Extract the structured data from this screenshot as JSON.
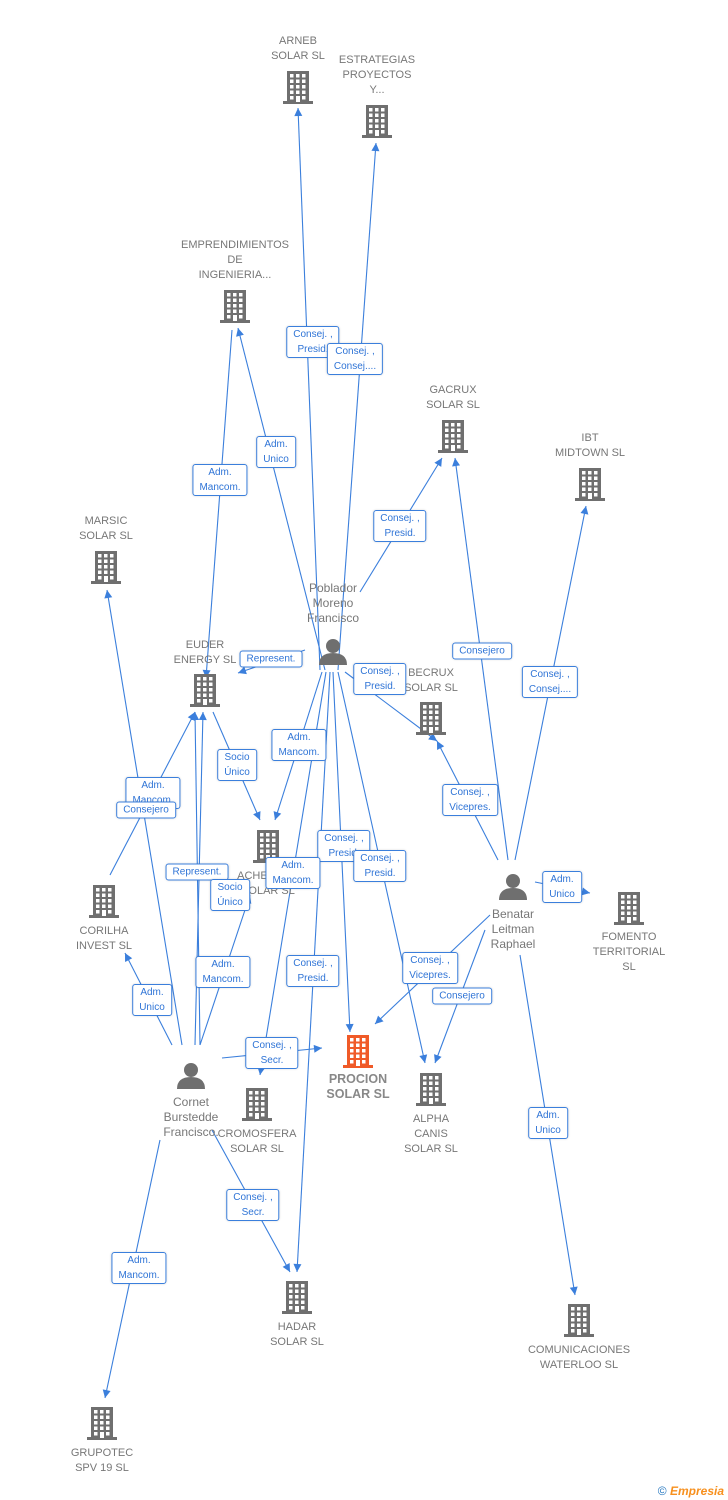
{
  "colors": {
    "edge": "#3b7fdc",
    "node": "#6f6f6f",
    "focus": "#f05a28"
  },
  "nodes": [
    {
      "id": "arneb",
      "type": "company",
      "label": "ARNEB\nSOLAR SL"
    },
    {
      "id": "estrategias",
      "type": "company",
      "label": "ESTRATEGIAS\nPROYECTOS\nY..."
    },
    {
      "id": "emprendimientos",
      "type": "company",
      "label": "EMPRENDIMIENTOS\nDE\nINGENIERIA..."
    },
    {
      "id": "gacrux",
      "type": "company",
      "label": "GACRUX\nSOLAR SL"
    },
    {
      "id": "ibt",
      "type": "company",
      "label": "IBT\nMIDTOWN SL"
    },
    {
      "id": "marsic",
      "type": "company",
      "label": "MARSIC\nSOLAR SL"
    },
    {
      "id": "poblador",
      "type": "person",
      "label": "Poblador\nMoreno\nFrancisco"
    },
    {
      "id": "euder",
      "type": "company",
      "label": "EUDER\nENERGY SL"
    },
    {
      "id": "becrux",
      "type": "company",
      "label": "BECRUX\nSOLAR SL"
    },
    {
      "id": "achernar",
      "type": "company",
      "label": "ACHERNAR\nSOLAR SL"
    },
    {
      "id": "corilha",
      "type": "company",
      "label": "CORILHA\nINVEST SL"
    },
    {
      "id": "benatar",
      "type": "person",
      "label": "Benatar\nLeitman\nRaphael"
    },
    {
      "id": "fomento",
      "type": "company",
      "label": "FOMENTO\nTERRITORIAL\nSL"
    },
    {
      "id": "cornet",
      "type": "person",
      "label": "Cornet\nBurstedde\nFrancisco."
    },
    {
      "id": "procion",
      "type": "focus",
      "label": "PROCION\nSOLAR SL"
    },
    {
      "id": "cromosfera",
      "type": "company",
      "label": "CROMOSFERA\nSOLAR SL"
    },
    {
      "id": "alpha",
      "type": "company",
      "label": "ALPHA\nCANIS\nSOLAR SL"
    },
    {
      "id": "hadar",
      "type": "company",
      "label": "HADAR\nSOLAR SL"
    },
    {
      "id": "comunicaciones",
      "type": "company",
      "label": "COMUNICACIONES\nWATERLOO SL"
    },
    {
      "id": "grupotec",
      "type": "company",
      "label": "GRUPOTEC\nSPV 19 SL"
    }
  ],
  "edges": [
    {
      "from": "poblador",
      "to": "arneb",
      "label": "Consej. ,\nPresid."
    },
    {
      "from": "poblador",
      "to": "estrategias",
      "label": "Consej. ,\nConsej...."
    },
    {
      "from": "poblador",
      "to": "emprendimientos",
      "label": "Adm.\nUnico"
    },
    {
      "from": "poblador",
      "to": "gacrux",
      "label": "Consej. ,\nPresid."
    },
    {
      "from": "poblador",
      "to": "euder",
      "label": "Represent."
    },
    {
      "from": "poblador",
      "to": "becrux",
      "label": "Consej. ,\nPresid."
    },
    {
      "from": "poblador",
      "to": "achernar",
      "label": "Adm.\nMancom."
    },
    {
      "from": "poblador",
      "to": "procion",
      "label": "Consej. ,\nPresid."
    },
    {
      "from": "poblador",
      "to": "alpha",
      "label": "Consej. ,\nPresid."
    },
    {
      "from": "poblador",
      "to": "hadar",
      "label": "Consej. ,\nPresid."
    },
    {
      "from": "poblador",
      "to": "cromosfera",
      "label": "Adm.\nMancom."
    },
    {
      "from": "emprendimientos",
      "to": "euder",
      "label": "Adm.\nMancom."
    },
    {
      "from": "benatar",
      "to": "gacrux",
      "label": "Consejero"
    },
    {
      "from": "benatar",
      "to": "ibt",
      "label": "Consej. ,\nConsej...."
    },
    {
      "from": "benatar",
      "to": "becrux",
      "label": "Consej. ,\nVicepres."
    },
    {
      "from": "benatar",
      "to": "fomento",
      "label": "Adm.\nUnico"
    },
    {
      "from": "benatar",
      "to": "procion",
      "label": "Consej. ,\nVicepres."
    },
    {
      "from": "benatar",
      "to": "alpha",
      "label": "Consejero"
    },
    {
      "from": "benatar",
      "to": "comunicaciones",
      "label": "Adm.\nUnico"
    },
    {
      "from": "cornet",
      "to": "marsic",
      "label": "Adm.\nMancom."
    },
    {
      "from": "corilha",
      "to": "euder",
      "label": "Consejero"
    },
    {
      "from": "cornet",
      "to": "corilha",
      "label": "Adm.\nUnico"
    },
    {
      "from": "cornet",
      "to": "euder",
      "label": "Represent."
    },
    {
      "from": "euder",
      "to": "achernar",
      "label": "Socio\nÚnico"
    },
    {
      "from": "cornet",
      "to": "achernar",
      "label": "Socio\nÚnico"
    },
    {
      "from": "cornet",
      "to": "euder2",
      "label": "Adm.\nMancom."
    },
    {
      "from": "cornet",
      "to": "procion",
      "label": "Consej. ,\nSecr."
    },
    {
      "from": "cornet",
      "to": "hadar",
      "label": "Consej. ,\nSecr."
    },
    {
      "from": "cornet",
      "to": "grupotec",
      "label": "Adm.\nMancom."
    }
  ],
  "footer": {
    "copyright": "©",
    "brand": "Empresia"
  }
}
